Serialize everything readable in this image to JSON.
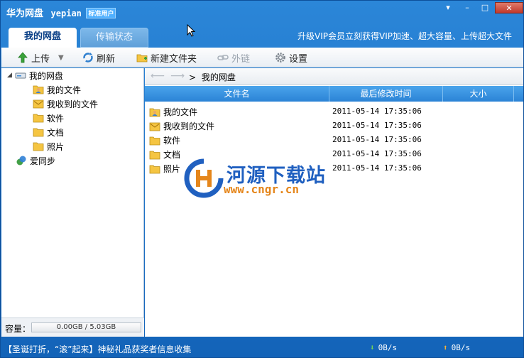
{
  "window": {
    "app_title": "华为网盘",
    "username": "yepian",
    "user_badge": "标准用户",
    "controls": {
      "arrow": "▾",
      "minimize": "–",
      "maximize": "□",
      "close": "✕"
    }
  },
  "tabs": [
    {
      "label": "我的网盘",
      "active": true
    },
    {
      "label": "传输状态",
      "active": false
    }
  ],
  "promo_text": "升级VIP会员立刻获得VIP加速、超大容量、上传超大文件",
  "toolbar": {
    "upload": "上传",
    "refresh": "刷新",
    "new_folder": "新建文件夹",
    "external_link": "外链",
    "settings": "设置"
  },
  "sidebar": {
    "root": "我的网盘",
    "items": [
      {
        "label": "我的文件",
        "icon": "user-folder-icon"
      },
      {
        "label": "我收到的文件",
        "icon": "mail-folder-icon"
      },
      {
        "label": "软件",
        "icon": "folder-icon"
      },
      {
        "label": "文档",
        "icon": "folder-icon"
      },
      {
        "label": "照片",
        "icon": "folder-icon"
      }
    ],
    "sync": "爱同步",
    "quota_label": "容量：",
    "quota_value": "0.00GB / 5.03GB"
  },
  "breadcrumb": {
    "current": "我的网盘",
    "separator": ">"
  },
  "table": {
    "columns": [
      "文件名",
      "最后修改时间",
      "大小"
    ],
    "rows": [
      {
        "name": "我的文件",
        "modified": "2011-05-14 17:35:06",
        "size": "",
        "icon": "user-folder-icon"
      },
      {
        "name": "我收到的文件",
        "modified": "2011-05-14 17:35:06",
        "size": "",
        "icon": "mail-folder-icon"
      },
      {
        "name": "软件",
        "modified": "2011-05-14 17:35:06",
        "size": "",
        "icon": "folder-icon"
      },
      {
        "name": "文档",
        "modified": "2011-05-14 17:35:06",
        "size": "",
        "icon": "folder-icon"
      },
      {
        "name": "照片",
        "modified": "2011-05-14 17:35:06",
        "size": "",
        "icon": "folder-icon"
      }
    ]
  },
  "status": {
    "message": "【圣诞打折，“滚”起来】神秘礼品获奖者信息收集",
    "download_speed": "0B/s",
    "upload_speed": "0B/s"
  },
  "watermark": {
    "title": "河源下载站",
    "url": "www.cngr.cn"
  },
  "colors": {
    "accent": "#1a6fc4",
    "header": "#3a95e3",
    "folder": "#f5c542",
    "watermark_blue": "#2060c0",
    "watermark_orange": "#e5861b"
  }
}
